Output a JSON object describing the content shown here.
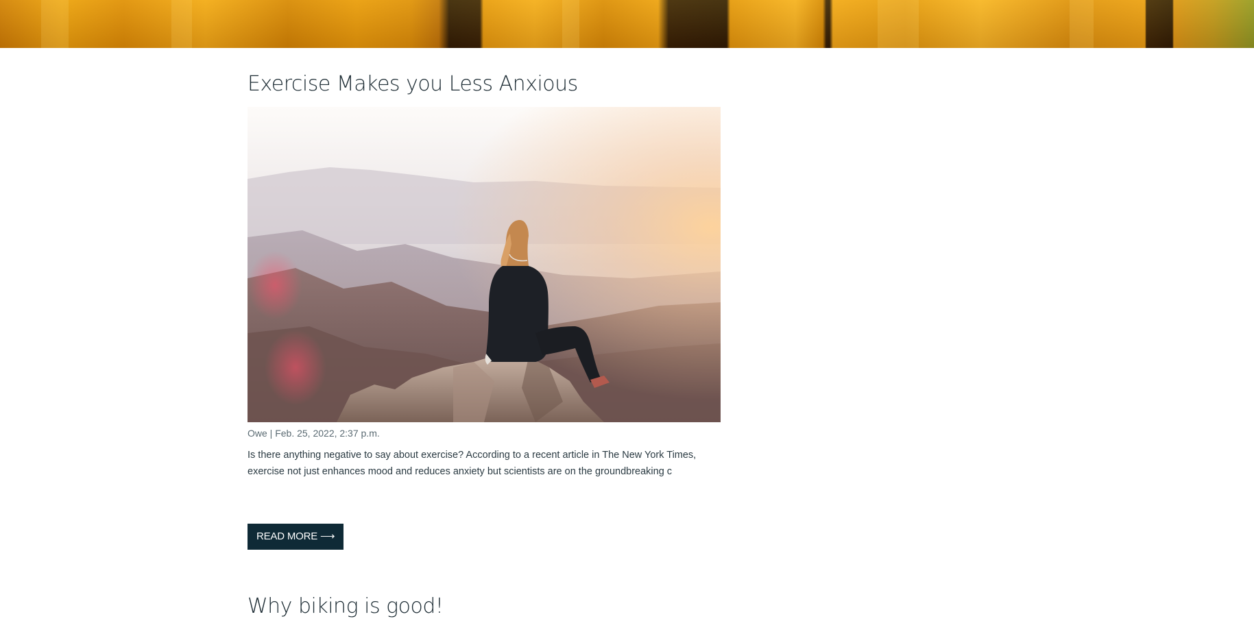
{
  "hero": {
    "image_icon": "hero-background-image",
    "accent_colors": [
      "#e49c10",
      "#0b0704"
    ]
  },
  "posts": [
    {
      "title": "Exercise Makes you Less Anxious",
      "image_icon": "woman-on-mountain-photo",
      "meta": "Owe | Feb. 25, 2022, 2:37 p.m.",
      "excerpt": "Is there anything negative to say about exercise? According to a recent article in The New York Times, exercise not just enhances mood and reduces anxiety but scientists are on the groundbreaking c",
      "read_more_label": "READ MORE ⟶"
    },
    {
      "title": "Why biking is good!"
    }
  ],
  "colors": {
    "text": "#1c2b33",
    "button_bg": "#0f2a36",
    "button_text": "#ffffff",
    "meta_text": "#5a6a72"
  }
}
